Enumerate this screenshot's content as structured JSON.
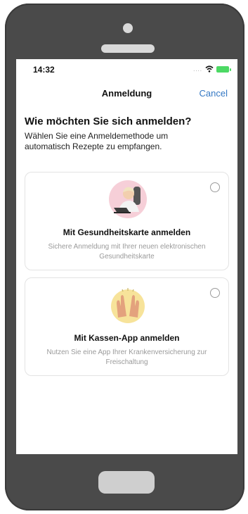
{
  "status": {
    "time": "14:32"
  },
  "nav": {
    "title": "Anmeldung",
    "cancel_label": "Cancel"
  },
  "main": {
    "heading": "Wie möchten Sie sich anmelden?",
    "subtitle": "Wählen Sie eine Anmeldemethode um automatisch Rezepte zu empfangen.",
    "options": [
      {
        "title": "Mit Gesundheitskarte anmelden",
        "description": "Sichere Anmeldung mit Ihrer neuen elektronischen Gesundheitskarte",
        "icon": "person-with-laptop-illustration"
      },
      {
        "title": "Mit Kassen-App anmelden",
        "description": "Nutzen Sie eine App Ihrer Krankenversicherung zur Freischaltung",
        "icon": "raised-hands-illustration"
      }
    ]
  },
  "colors": {
    "accent": "#3478c4",
    "battery": "#4cd964",
    "phone_body": "#4a4a4a"
  }
}
